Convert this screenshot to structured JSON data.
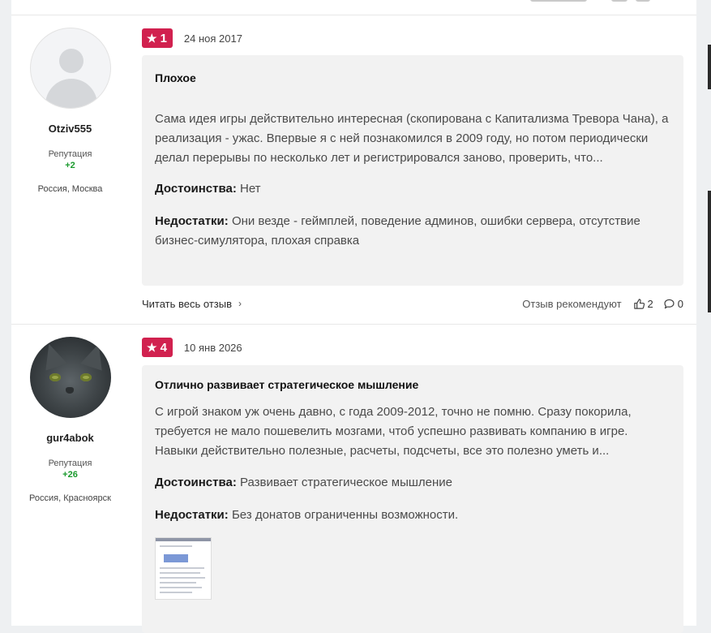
{
  "colors": {
    "accent": "#d1214f",
    "reputation": "#1a9a2d",
    "panel": "#f2f2f2"
  },
  "reviews": [
    {
      "author": {
        "name": "Otziv555",
        "reputation_label": "Репутация",
        "reputation": "+2",
        "location": "Россия, Москва"
      },
      "rating": "1",
      "date": "24 ноя 2017",
      "title": "Плохое",
      "text": "Сама идея игры действительно интересная (скопирована с Капитализма Тревора Чана), а реализация - ужас. Впервые я с ней познакомился в 2009 году, но потом периодически делал перерывы по несколько лет и регистрировался заново, проверить, что...",
      "pros_label": "Достоинства:",
      "pros": "Нет",
      "cons_label": "Недостатки:",
      "cons": "Они везде - геймплей, поведение админов, ошибки сервера, отсутствие бизнес-симулятора, плохая справка",
      "read_all": "Читать весь отзыв",
      "recommend": "Отзыв рекомендуют",
      "likes": "2",
      "comments": "0"
    },
    {
      "author": {
        "name": "gur4abok",
        "reputation_label": "Репутация",
        "reputation": "+26",
        "location": "Россия, Красноярск"
      },
      "rating": "4",
      "date": "10 янв 2026",
      "title": "Отлично развивает стратегическое мышление",
      "text": "С игрой знаком уж очень давно, с года 2009-2012, точно не помню. Сразу покорила, требуется не мало пошевелить мозгами, чтоб успешно развивать компанию в игре. Навыки действительно полезные, расчеты, подсчеты, все это полезно уметь и...",
      "pros_label": "Достоинства:",
      "pros": "Развивает стратегическое мышление",
      "cons_label": "Недостатки:",
      "cons": "Без донатов ограниченны возможности."
    }
  ]
}
